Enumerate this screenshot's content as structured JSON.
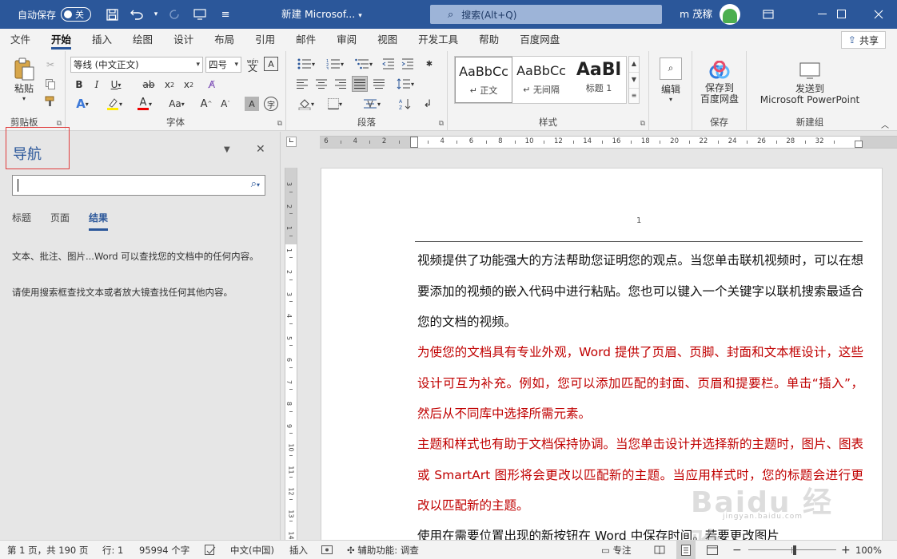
{
  "titlebar": {
    "autosave_label": "自动保存",
    "autosave_state": "关",
    "title": "新建 Microsof...",
    "search_placeholder": "搜索(Alt+Q)",
    "user": "m 茂稼",
    "bg": "#2b579a"
  },
  "tabs": [
    "文件",
    "开始",
    "插入",
    "绘图",
    "设计",
    "布局",
    "引用",
    "邮件",
    "审阅",
    "视图",
    "开发工具",
    "帮助",
    "百度网盘"
  ],
  "active_tab": "开始",
  "share_label": "共享",
  "ribbon": {
    "clipboard": {
      "label": "剪贴板",
      "paste": "粘贴"
    },
    "font": {
      "label": "字体",
      "font_name": "等线 (中文正文)",
      "font_size": "四号",
      "wen": "wén"
    },
    "paragraph": {
      "label": "段落"
    },
    "styles": {
      "label": "样式",
      "items": [
        {
          "preview": "AaBbCc",
          "name": "正文"
        },
        {
          "preview": "AaBbCc",
          "name": "无间隔"
        },
        {
          "preview": "AaBl",
          "name": "标题 1"
        }
      ]
    },
    "editing": {
      "label": "编辑"
    },
    "save": {
      "label": "保存",
      "btn_line1": "保存到",
      "btn_line2": "百度网盘"
    },
    "newgroup": {
      "label": "新建组",
      "btn_line1": "发送到",
      "btn_line2": "Microsoft PowerPoint"
    }
  },
  "nav": {
    "title": "导航",
    "tabs": [
      "标题",
      "页面",
      "结果"
    ],
    "active_tab": "结果",
    "msg1": "文本、批注、图片...Word 可以查找您的文档中的任何内容。",
    "msg2": "请使用搜索框查找文本或者放大镜查找任何其他内容。"
  },
  "hruler_labels": [
    "6",
    "4",
    "2",
    "2",
    "4",
    "6",
    "8",
    "10",
    "12",
    "14",
    "16",
    "18",
    "20",
    "22",
    "24",
    "26",
    "28",
    "32"
  ],
  "vruler_labels": [
    "3",
    "2",
    "1",
    "1",
    "2",
    "3",
    "4",
    "5",
    "6",
    "7",
    "8",
    "9",
    "10",
    "11",
    "12",
    "13",
    "14"
  ],
  "document": {
    "page_number": "1",
    "paragraphs": [
      {
        "text": "视频提供了功能强大的方法帮助您证明您的观点。当您单击联机视频时，可以在想要添加的视频的嵌入代码中进行粘贴。您也可以键入一个关键字以联机搜索最适合您的文档的视频。",
        "color": "#111111"
      },
      {
        "text": "为使您的文档具有专业外观，Word 提供了页眉、页脚、封面和文本框设计，这些设计可互为补充。例如，您可以添加匹配的封面、页眉和提要栏。单击“插入”，然后从不同库中选择所需元素。",
        "color": "#c00000"
      },
      {
        "text": "主题和样式也有助于文档保持协调。当您单击设计并选择新的主题时，图片、图表或 SmartArt 图形将会更改以匹配新的主题。当应用样式时，您的标题会进行更改以匹配新的主题。",
        "color": "#c00000"
      },
      {
        "text": "使用在需要位置出现的新按钮在 Word 中保存时间。若要更改图片",
        "color": "#111111"
      }
    ]
  },
  "watermark": {
    "main": "Baidu 经验",
    "sub": "jingyan.baidu.com"
  },
  "statusbar": {
    "page": "第 1 页，共 190 页",
    "line": "行: 1",
    "words": "95994 个字",
    "lang": "中文(中国)",
    "mode": "插入",
    "accessibility": "辅助功能: 调查",
    "focus": "专注",
    "zoom": "100%"
  }
}
